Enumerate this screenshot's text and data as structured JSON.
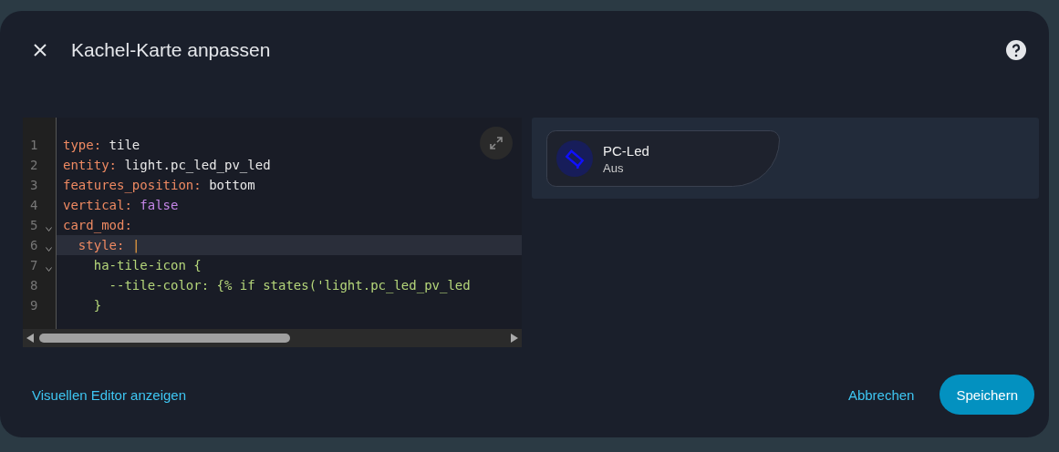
{
  "dialog": {
    "title": "Kachel-Karte anpassen"
  },
  "editor": {
    "lines": [
      {
        "number": "1",
        "fold": false,
        "active": false,
        "tokens": [
          {
            "kind": "key",
            "text": "type"
          },
          {
            "kind": "punct",
            "text": ": "
          },
          {
            "kind": "plain",
            "text": "tile"
          }
        ]
      },
      {
        "number": "2",
        "fold": false,
        "active": false,
        "tokens": [
          {
            "kind": "key",
            "text": "entity"
          },
          {
            "kind": "punct",
            "text": ": "
          },
          {
            "kind": "plain",
            "text": "light.pc_led_pv_led"
          }
        ]
      },
      {
        "number": "3",
        "fold": false,
        "active": false,
        "tokens": [
          {
            "kind": "key",
            "text": "features_position"
          },
          {
            "kind": "punct",
            "text": ": "
          },
          {
            "kind": "plain",
            "text": "bottom"
          }
        ]
      },
      {
        "number": "4",
        "fold": false,
        "active": false,
        "tokens": [
          {
            "kind": "key",
            "text": "vertical"
          },
          {
            "kind": "punct",
            "text": ": "
          },
          {
            "kind": "bool",
            "text": "false"
          }
        ]
      },
      {
        "number": "5",
        "fold": true,
        "active": false,
        "tokens": [
          {
            "kind": "key",
            "text": "card_mod"
          },
          {
            "kind": "punct",
            "text": ":"
          }
        ]
      },
      {
        "number": "6",
        "fold": true,
        "active": true,
        "tokens": [
          {
            "kind": "key",
            "text": "  style"
          },
          {
            "kind": "punct",
            "text": ": "
          },
          {
            "kind": "pipe",
            "text": "|"
          }
        ]
      },
      {
        "number": "7",
        "fold": true,
        "active": false,
        "tokens": [
          {
            "kind": "string",
            "text": "    ha-tile-icon {"
          }
        ]
      },
      {
        "number": "8",
        "fold": false,
        "active": false,
        "tokens": [
          {
            "kind": "string",
            "text": "      --tile-color: {% if states('light.pc_led_pv_led"
          }
        ]
      },
      {
        "number": "9",
        "fold": false,
        "active": false,
        "tokens": [
          {
            "kind": "string",
            "text": "    }"
          }
        ]
      }
    ],
    "scrollbar_visible": true
  },
  "preview": {
    "tile": {
      "name": "PC-Led",
      "state": "Aus"
    }
  },
  "footer": {
    "link": "Visuellen Editor anzeigen",
    "cancel": "Abbrechen",
    "save": "Speichern"
  }
}
